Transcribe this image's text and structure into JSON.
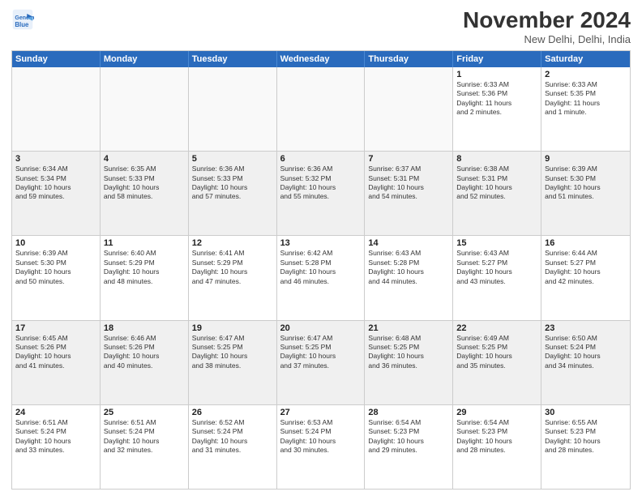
{
  "logo": {
    "line1": "General",
    "line2": "Blue"
  },
  "title": "November 2024",
  "subtitle": "New Delhi, Delhi, India",
  "header": {
    "days": [
      "Sunday",
      "Monday",
      "Tuesday",
      "Wednesday",
      "Thursday",
      "Friday",
      "Saturday"
    ]
  },
  "weeks": [
    {
      "cells": [
        {
          "day": "",
          "info": "",
          "empty": true
        },
        {
          "day": "",
          "info": "",
          "empty": true
        },
        {
          "day": "",
          "info": "",
          "empty": true
        },
        {
          "day": "",
          "info": "",
          "empty": true
        },
        {
          "day": "",
          "info": "",
          "empty": true
        },
        {
          "day": "1",
          "info": "Sunrise: 6:33 AM\nSunset: 5:36 PM\nDaylight: 11 hours\nand 2 minutes."
        },
        {
          "day": "2",
          "info": "Sunrise: 6:33 AM\nSunset: 5:35 PM\nDaylight: 11 hours\nand 1 minute."
        }
      ]
    },
    {
      "cells": [
        {
          "day": "3",
          "info": "Sunrise: 6:34 AM\nSunset: 5:34 PM\nDaylight: 10 hours\nand 59 minutes."
        },
        {
          "day": "4",
          "info": "Sunrise: 6:35 AM\nSunset: 5:33 PM\nDaylight: 10 hours\nand 58 minutes."
        },
        {
          "day": "5",
          "info": "Sunrise: 6:36 AM\nSunset: 5:33 PM\nDaylight: 10 hours\nand 57 minutes."
        },
        {
          "day": "6",
          "info": "Sunrise: 6:36 AM\nSunset: 5:32 PM\nDaylight: 10 hours\nand 55 minutes."
        },
        {
          "day": "7",
          "info": "Sunrise: 6:37 AM\nSunset: 5:31 PM\nDaylight: 10 hours\nand 54 minutes."
        },
        {
          "day": "8",
          "info": "Sunrise: 6:38 AM\nSunset: 5:31 PM\nDaylight: 10 hours\nand 52 minutes."
        },
        {
          "day": "9",
          "info": "Sunrise: 6:39 AM\nSunset: 5:30 PM\nDaylight: 10 hours\nand 51 minutes."
        }
      ]
    },
    {
      "cells": [
        {
          "day": "10",
          "info": "Sunrise: 6:39 AM\nSunset: 5:30 PM\nDaylight: 10 hours\nand 50 minutes."
        },
        {
          "day": "11",
          "info": "Sunrise: 6:40 AM\nSunset: 5:29 PM\nDaylight: 10 hours\nand 48 minutes."
        },
        {
          "day": "12",
          "info": "Sunrise: 6:41 AM\nSunset: 5:29 PM\nDaylight: 10 hours\nand 47 minutes."
        },
        {
          "day": "13",
          "info": "Sunrise: 6:42 AM\nSunset: 5:28 PM\nDaylight: 10 hours\nand 46 minutes."
        },
        {
          "day": "14",
          "info": "Sunrise: 6:43 AM\nSunset: 5:28 PM\nDaylight: 10 hours\nand 44 minutes."
        },
        {
          "day": "15",
          "info": "Sunrise: 6:43 AM\nSunset: 5:27 PM\nDaylight: 10 hours\nand 43 minutes."
        },
        {
          "day": "16",
          "info": "Sunrise: 6:44 AM\nSunset: 5:27 PM\nDaylight: 10 hours\nand 42 minutes."
        }
      ]
    },
    {
      "cells": [
        {
          "day": "17",
          "info": "Sunrise: 6:45 AM\nSunset: 5:26 PM\nDaylight: 10 hours\nand 41 minutes."
        },
        {
          "day": "18",
          "info": "Sunrise: 6:46 AM\nSunset: 5:26 PM\nDaylight: 10 hours\nand 40 minutes."
        },
        {
          "day": "19",
          "info": "Sunrise: 6:47 AM\nSunset: 5:25 PM\nDaylight: 10 hours\nand 38 minutes."
        },
        {
          "day": "20",
          "info": "Sunrise: 6:47 AM\nSunset: 5:25 PM\nDaylight: 10 hours\nand 37 minutes."
        },
        {
          "day": "21",
          "info": "Sunrise: 6:48 AM\nSunset: 5:25 PM\nDaylight: 10 hours\nand 36 minutes."
        },
        {
          "day": "22",
          "info": "Sunrise: 6:49 AM\nSunset: 5:25 PM\nDaylight: 10 hours\nand 35 minutes."
        },
        {
          "day": "23",
          "info": "Sunrise: 6:50 AM\nSunset: 5:24 PM\nDaylight: 10 hours\nand 34 minutes."
        }
      ]
    },
    {
      "cells": [
        {
          "day": "24",
          "info": "Sunrise: 6:51 AM\nSunset: 5:24 PM\nDaylight: 10 hours\nand 33 minutes."
        },
        {
          "day": "25",
          "info": "Sunrise: 6:51 AM\nSunset: 5:24 PM\nDaylight: 10 hours\nand 32 minutes."
        },
        {
          "day": "26",
          "info": "Sunrise: 6:52 AM\nSunset: 5:24 PM\nDaylight: 10 hours\nand 31 minutes."
        },
        {
          "day": "27",
          "info": "Sunrise: 6:53 AM\nSunset: 5:24 PM\nDaylight: 10 hours\nand 30 minutes."
        },
        {
          "day": "28",
          "info": "Sunrise: 6:54 AM\nSunset: 5:23 PM\nDaylight: 10 hours\nand 29 minutes."
        },
        {
          "day": "29",
          "info": "Sunrise: 6:54 AM\nSunset: 5:23 PM\nDaylight: 10 hours\nand 28 minutes."
        },
        {
          "day": "30",
          "info": "Sunrise: 6:55 AM\nSunset: 5:23 PM\nDaylight: 10 hours\nand 28 minutes."
        }
      ]
    }
  ]
}
